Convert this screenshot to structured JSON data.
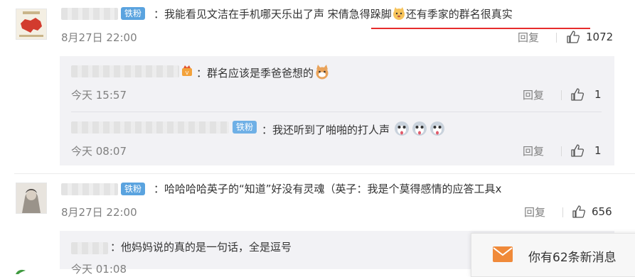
{
  "comments": [
    {
      "badge": "铁粉",
      "text_before": "：我能看见文洁在手机哪天乐出了声 宋倩急得跺脚",
      "text_after": "还有季家的群名很真实",
      "time": "8月27日 22:00",
      "reply_label": "回复",
      "likes": "1072"
    },
    {
      "badge": "铁粉",
      "text": "：哈哈哈哈英子的“知道”好没有灵魂（英子：我是个莫得感情的应答工具x",
      "time": "8月27日 22:00",
      "reply_label": "回复",
      "likes": "656"
    }
  ],
  "replies": [
    {
      "text": "：群名应该是季爸爸想的",
      "time": "今天 15:57",
      "reply_label": "回复",
      "likes": "1"
    },
    {
      "badge": "铁粉",
      "text": "：我还听到了啪啪的打人声",
      "time": "今天 08:07",
      "reply_label": "回复",
      "likes": "1"
    },
    {
      "text": "：他妈妈说的真的是一句话，全是逗号",
      "time": "今天 01:08"
    }
  ],
  "notice": {
    "text": "你有62条新消息",
    "icon": "mail-icon"
  },
  "colors": {
    "badge": "#6fb0e6",
    "accent_underline": "#e62d2d",
    "notice_icon": "#f08a3a"
  }
}
